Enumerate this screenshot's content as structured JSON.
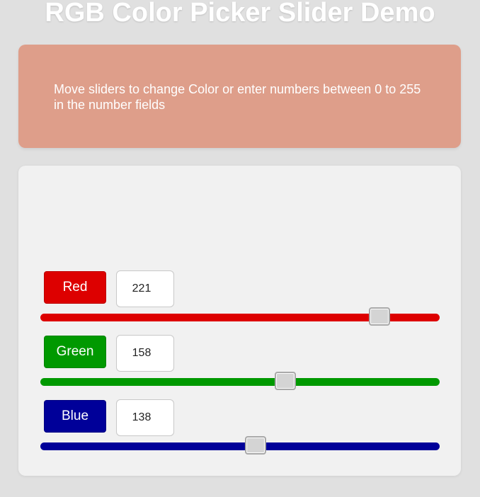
{
  "header": {
    "title": "RGB Color Picker Slider Demo"
  },
  "info": {
    "text": "Move sliders to change Color or enter numbers between 0 to 255 in the number fields",
    "background_color": "#de9e8a"
  },
  "channels": [
    {
      "label": "Red",
      "value": "221",
      "color": "#dd0000",
      "min": 0,
      "max": 255
    },
    {
      "label": "Green",
      "value": "158",
      "color": "#009900",
      "min": 0,
      "max": 255
    },
    {
      "label": "Blue",
      "value": "138",
      "color": "#000099",
      "min": 0,
      "max": 255
    }
  ],
  "icons": {
    "slider_thumb": "slider-handle-icon"
  }
}
